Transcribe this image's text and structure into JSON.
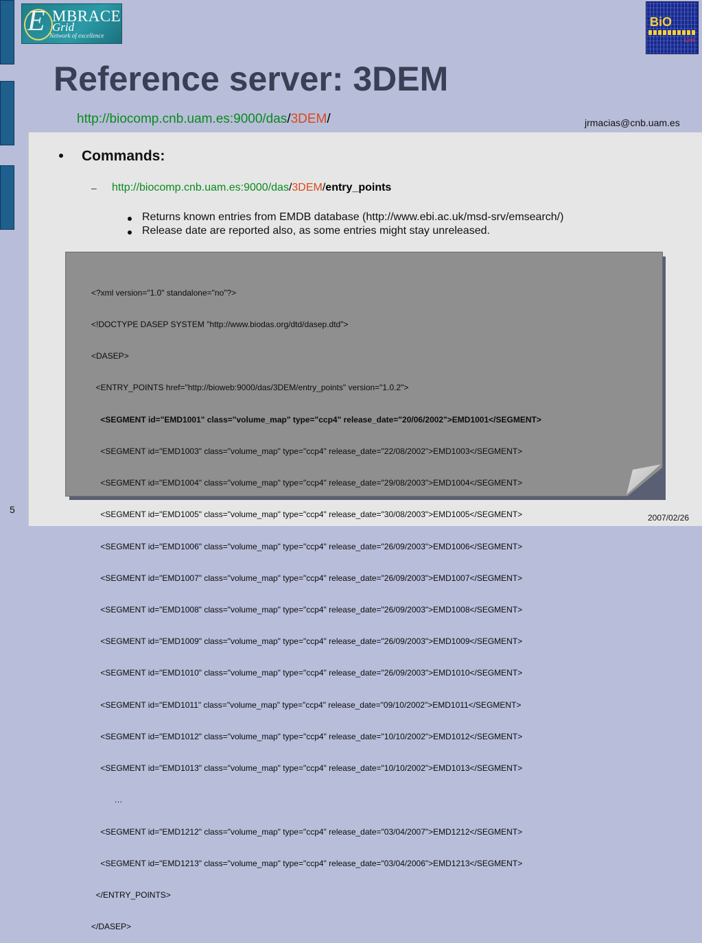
{
  "logos": {
    "left": {
      "em": "E",
      "line1": "MBRACE",
      "line2": "Grid",
      "tagline": "Network of excellence"
    },
    "right": {
      "bio": "BiO",
      "unit": "Unit"
    }
  },
  "slide": {
    "title": "Reference server: 3DEM",
    "url": {
      "base": "http://biocomp.cnb.uam.es:9000/das",
      "sep1": "/",
      "part": "3DEM",
      "sep2": "/"
    },
    "email": "jrmacias@cnb.uam.es",
    "page_number": "5",
    "date": "2007/02/26"
  },
  "bullets": {
    "heading": "Commands:",
    "cmd": {
      "base": "http://biocomp.cnb.uam.es:9000/das",
      "sep1": "/",
      "part": "3DEM",
      "sep2": "/",
      "endpoint": "entry_points",
      "dash": "–"
    },
    "items": [
      "Returns known entries from EMDB database (http://www.ebi.ac.uk/msd-srv/emsearch/)",
      "Release date are reported also, as some entries might stay unreleased."
    ]
  },
  "xml_lines": [
    "<?xml version=\"1.0\" standalone=\"no\"?>",
    "<!DOCTYPE DASEP SYSTEM \"http://www.biodas.org/dtd/dasep.dtd\">",
    "<DASEP>",
    "  <ENTRY_POINTS href=\"http://bioweb:9000/das/3DEM/entry_points\" version=\"1.0.2\">",
    "    <SEGMENT id=\"EMD1001\" class=\"volume_map\" type=\"ccp4\" release_date=\"20/06/2002\">EMD1001</SEGMENT>",
    "    <SEGMENT id=\"EMD1003\" class=\"volume_map\" type=\"ccp4\" release_date=\"22/08/2002\">EMD1003</SEGMENT>",
    "    <SEGMENT id=\"EMD1004\" class=\"volume_map\" type=\"ccp4\" release_date=\"29/08/2003\">EMD1004</SEGMENT>",
    "    <SEGMENT id=\"EMD1005\" class=\"volume_map\" type=\"ccp4\" release_date=\"30/08/2003\">EMD1005</SEGMENT>",
    "    <SEGMENT id=\"EMD1006\" class=\"volume_map\" type=\"ccp4\" release_date=\"26/09/2003\">EMD1006</SEGMENT>",
    "    <SEGMENT id=\"EMD1007\" class=\"volume_map\" type=\"ccp4\" release_date=\"26/09/2003\">EMD1007</SEGMENT>",
    "    <SEGMENT id=\"EMD1008\" class=\"volume_map\" type=\"ccp4\" release_date=\"26/09/2003\">EMD1008</SEGMENT>",
    "    <SEGMENT id=\"EMD1009\" class=\"volume_map\" type=\"ccp4\" release_date=\"26/09/2003\">EMD1009</SEGMENT>",
    "    <SEGMENT id=\"EMD1010\" class=\"volume_map\" type=\"ccp4\" release_date=\"26/09/2003\">EMD1010</SEGMENT>",
    "    <SEGMENT id=\"EMD1011\" class=\"volume_map\" type=\"ccp4\" release_date=\"09/10/2002\">EMD1011</SEGMENT>",
    "    <SEGMENT id=\"EMD1012\" class=\"volume_map\" type=\"ccp4\" release_date=\"10/10/2002\">EMD1012</SEGMENT>",
    "    <SEGMENT id=\"EMD1013\" class=\"volume_map\" type=\"ccp4\" release_date=\"10/10/2002\">EMD1013</SEGMENT>",
    "          …",
    "    <SEGMENT id=\"EMD1212\" class=\"volume_map\" type=\"ccp4\" release_date=\"03/04/2007\">EMD1212</SEGMENT>",
    "    <SEGMENT id=\"EMD1213\" class=\"volume_map\" type=\"ccp4\" release_date=\"03/04/2006\">EMD1213</SEGMENT>",
    "  </ENTRY_POINTS>",
    "</DASEP>"
  ]
}
